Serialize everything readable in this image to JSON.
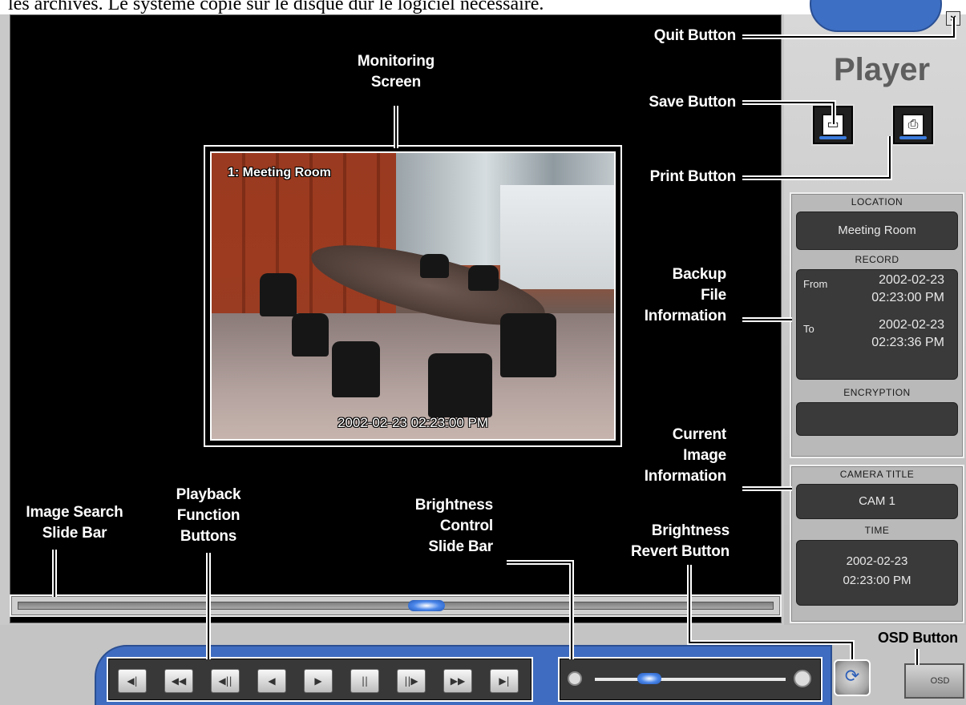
{
  "top_caption": "les archives. Le système copie sur le disque dur le logiciel nécessaire.",
  "player": {
    "title": "Player",
    "quit_glyph": "×"
  },
  "callouts": {
    "quit": "Quit Button",
    "save": "Save Button",
    "print": "Print Button",
    "monitoring_1": "Monitoring",
    "monitoring_2": "Screen",
    "backup_1": "Backup",
    "backup_2": "File",
    "backup_3": "Information",
    "current_1": "Current",
    "current_2": "Image",
    "current_3": "Information",
    "image_search_1": "Image Search",
    "image_search_2": "Slide Bar",
    "playback_1": "Playback",
    "playback_2": "Function",
    "playback_3": "Buttons",
    "brightness_1": "Brightness",
    "brightness_2": "Control",
    "brightness_3": "Slide Bar",
    "revert_1": "Brightness",
    "revert_2": "Revert Button",
    "osd": "OSD Button"
  },
  "video": {
    "camera_label": "1: Meeting Room",
    "timestamp": "2002-02-23 02:23:00 PM"
  },
  "backup_info": {
    "location_header": "LOCATION",
    "location_value": "Meeting Room",
    "record_header": "RECORD",
    "from_label": "From",
    "from_date": "2002-02-23",
    "from_time": "02:23:00 PM",
    "to_label": "To",
    "to_date": "2002-02-23",
    "to_time": "02:23:36 PM",
    "encryption_header": "ENCRYPTION",
    "encryption_value": ""
  },
  "current_info": {
    "camera_title_header": "CAMERA TITLE",
    "camera_title_value": "CAM 1",
    "time_header": "TIME",
    "time_date": "2002-02-23",
    "time_time": "02:23:00 PM"
  },
  "seek": {
    "position_fraction": 0.54
  },
  "brightness": {
    "level_fraction": 0.25
  },
  "playback_buttons": [
    "◀|",
    "◀◀",
    "◀||",
    "◀",
    "▶",
    "||",
    "||▶",
    "▶▶",
    "▶|"
  ],
  "osd_button_label": "OSD",
  "colors": {
    "accent_blue": "#3d6fc4",
    "screen_bg": "#000000",
    "panel_gray": "#c9c9c9"
  }
}
